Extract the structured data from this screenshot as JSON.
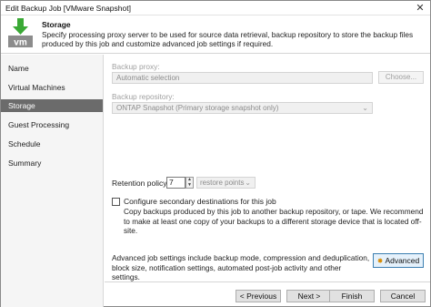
{
  "window": {
    "title": "Edit Backup Job [VMware Snapshot]",
    "close_glyph": "✕"
  },
  "header": {
    "icon": "vm-backup-icon",
    "title": "Storage",
    "description": "Specify processing proxy server to be used for source data retrieval, backup repository to store the backup files produced by this job and customize advanced job settings if required."
  },
  "sidebar": {
    "items": [
      {
        "label": "Name",
        "active": false
      },
      {
        "label": "Virtual Machines",
        "active": false
      },
      {
        "label": "Storage",
        "active": true
      },
      {
        "label": "Guest Processing",
        "active": false
      },
      {
        "label": "Schedule",
        "active": false
      },
      {
        "label": "Summary",
        "active": false
      }
    ]
  },
  "storage": {
    "backup_proxy_label": "Backup proxy:",
    "backup_proxy_value": "Automatic selection",
    "choose_button": "Choose...",
    "backup_repository_label": "Backup repository:",
    "backup_repository_value": "ONTAP Snapshot (Primary storage snapshot only)",
    "retention_label": "Retention policy:",
    "retention_value": "7",
    "retention_unit": "restore points",
    "secondary_checkbox_label": "Configure secondary destinations for this job",
    "secondary_checkbox_checked": false,
    "secondary_description": "Copy backups produced by this job to another backup repository, or tape. We recommend to make at least one copy of your backups to a different storage device that is located off-site.",
    "advanced_description": "Advanced job settings include backup mode, compression and deduplication, block size, notification settings, automated post-job activity and other settings.",
    "advanced_button": "Advanced"
  },
  "footer": {
    "previous": "< Previous",
    "next": "Next >",
    "finish": "Finish",
    "cancel": "Cancel"
  },
  "colors": {
    "active_nav": "#6b6b6b",
    "icon_green": "#3aa935",
    "icon_gray": "#8c8c8c",
    "advanced_border": "#3c7fb1"
  }
}
